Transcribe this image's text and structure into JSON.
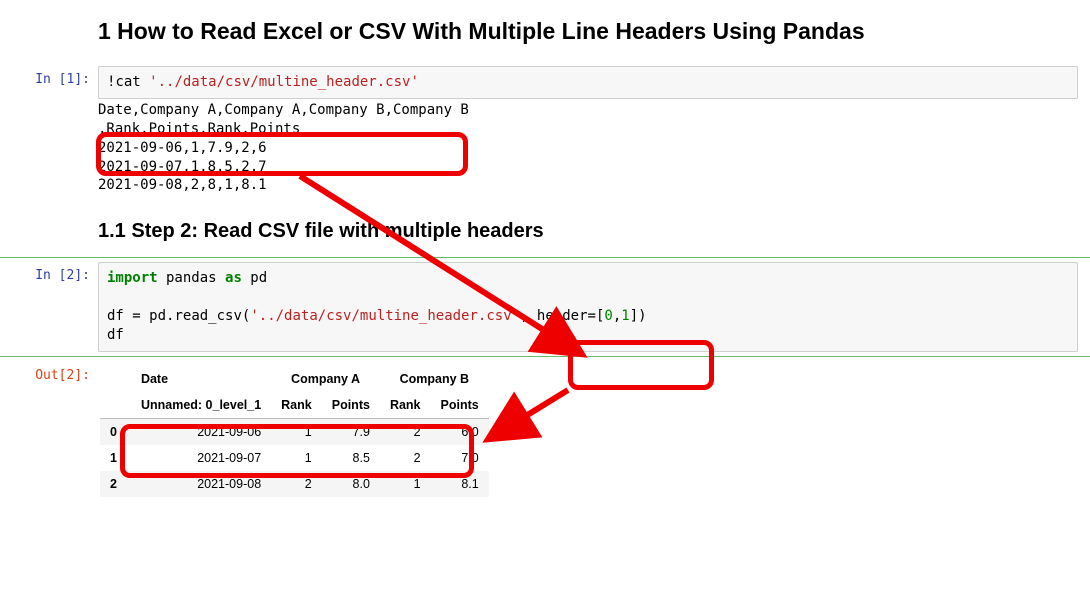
{
  "h1": "1  How to Read Excel or CSV With Multiple Line Headers Using Pandas",
  "h2": "1.1  Step 2: Read CSV file with multiple headers",
  "prompts": {
    "in1": "In [1]:",
    "in2": "In [2]:",
    "out2": "Out[2]:"
  },
  "cell1": {
    "bang": "!",
    "cmd": "cat ",
    "path": "'../data/csv/multine_header.csv'",
    "output": "Date,Company A,Company A,Company B,Company B\n,Rank,Points,Rank,Points\n2021-09-06,1,7.9,2,6\n2021-09-07,1,8.5,2,7\n2021-09-08,2,8,1,8.1"
  },
  "cell2": {
    "kw_import": "import",
    "mod": " pandas ",
    "kw_as": "as",
    "alias": " pd",
    "line2a": "df ",
    "eq": "=",
    "line2b": " pd",
    "dot": ".",
    "fn": "read_csv",
    "paren_o": "(",
    "arg_path": "'../data/csv/multine_header.csv'",
    "comma": ", ",
    "kw_header": "header",
    "eq2": "=",
    "br_o": "[",
    "n0": "0",
    "c2": ",",
    "n1": "1",
    "br_c": "]",
    "paren_c": ")",
    "line3": "df"
  },
  "df": {
    "top": [
      "Date",
      "Company A",
      "Company B"
    ],
    "sub": [
      "Unnamed: 0_level_1",
      "Rank",
      "Points",
      "Rank",
      "Points"
    ],
    "rows": [
      {
        "idx": "0",
        "date": "2021-09-06",
        "a_rank": "1",
        "a_pts": "7.9",
        "b_rank": "2",
        "b_pts": "6.0"
      },
      {
        "idx": "1",
        "date": "2021-09-07",
        "a_rank": "1",
        "a_pts": "8.5",
        "b_rank": "2",
        "b_pts": "7.0"
      },
      {
        "idx": "2",
        "date": "2021-09-08",
        "a_rank": "2",
        "a_pts": "8.0",
        "b_rank": "1",
        "b_pts": "8.1"
      }
    ]
  }
}
